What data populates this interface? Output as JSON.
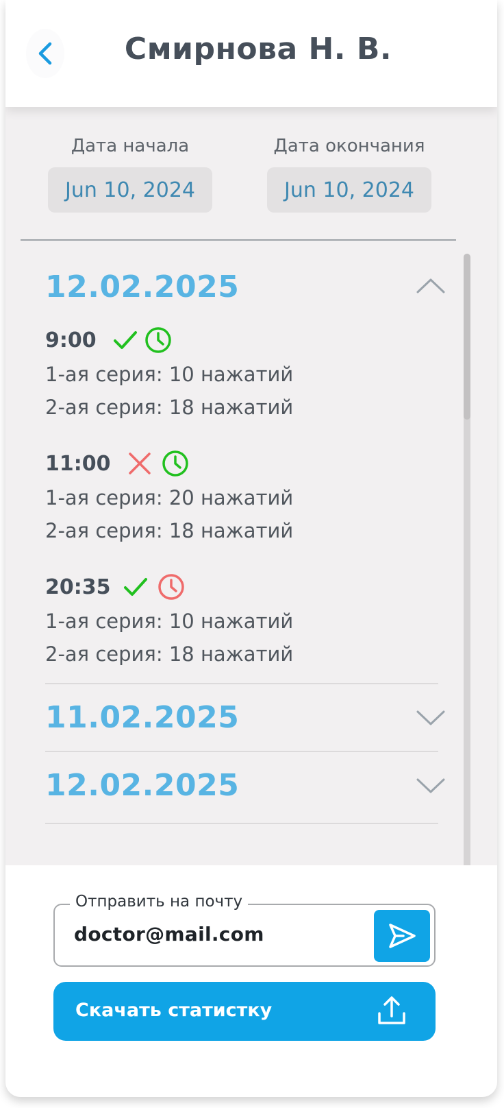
{
  "header": {
    "title": "Смирнова Н. В.",
    "back_icon": "chevron-left-icon"
  },
  "date_range": {
    "start_label": "Дата начала",
    "start_value": "Jun 10,  2024",
    "end_label": "Дата окончания",
    "end_value": "Jun 10,  2024"
  },
  "days": [
    {
      "date": "12.02.2025",
      "expanded": true,
      "sessions": [
        {
          "time": "9:00",
          "status_icon": "check-icon",
          "status_color": "#21c01f",
          "clock_icon": "clock-icon",
          "clock_color": "#21c01f",
          "series": [
            "1-ая серия: 10 нажатий",
            "2-ая серия: 18 нажатий"
          ]
        },
        {
          "time": "11:00",
          "status_icon": "cross-icon",
          "status_color": "#ef6b6b",
          "clock_icon": "clock-icon",
          "clock_color": "#21c01f",
          "series": [
            "1-ая серия: 20 нажатий",
            "2-ая серия: 18 нажатий"
          ]
        },
        {
          "time": "20:35",
          "status_icon": "check-icon",
          "status_color": "#21c01f",
          "clock_icon": "clock-icon",
          "clock_color": "#ef6b6b",
          "series": [
            "1-ая серия: 10 нажатий",
            "2-ая серия: 18 нажатий"
          ]
        }
      ]
    },
    {
      "date": "11.02.2025",
      "expanded": false
    },
    {
      "date": "12.02.2025",
      "expanded": false
    }
  ],
  "email": {
    "label": "Отправить на почту",
    "value": "doctor@mail.com",
    "send_icon": "send-icon"
  },
  "download": {
    "label": "Скачать статистку",
    "icon": "upload-icon"
  },
  "colors": {
    "accent": "#10a4e6",
    "date_heading": "#58b4e3",
    "success": "#21c01f",
    "error": "#ef6b6b"
  }
}
